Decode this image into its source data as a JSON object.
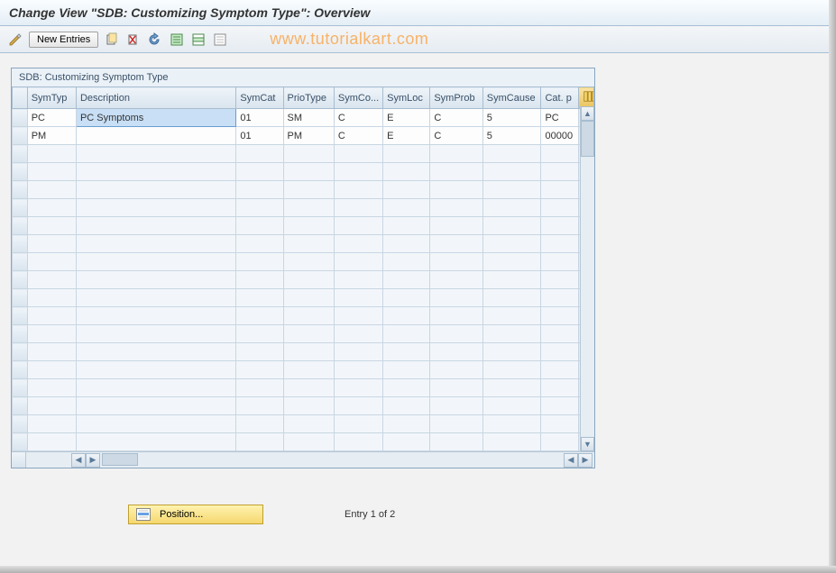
{
  "header": {
    "title": "Change View \"SDB: Customizing Symptom Type\": Overview"
  },
  "toolbar": {
    "new_entries_label": "New Entries"
  },
  "watermark": "www.tutorialkart.com",
  "panel": {
    "title": "SDB: Customizing Symptom Type"
  },
  "columns": [
    "SymTyp",
    "Description",
    "SymCat",
    "PrioType",
    "SymCo...",
    "SymLoc",
    "SymProb",
    "SymCause",
    "Cat. p"
  ],
  "rows": [
    {
      "symtyp": "PC",
      "description": "PC Symptoms",
      "symcat": "01",
      "priotype": "SM",
      "symco": "C",
      "symloc": "E",
      "symprob": "C",
      "symcause": "5",
      "catp": "PC"
    },
    {
      "symtyp": "PM",
      "description": "",
      "symcat": "01",
      "priotype": "PM",
      "symco": "C",
      "symloc": "E",
      "symprob": "C",
      "symcause": "5",
      "catp": "00000"
    }
  ],
  "footer": {
    "position_label": "Position...",
    "status_text": "Entry 1 of 2"
  }
}
